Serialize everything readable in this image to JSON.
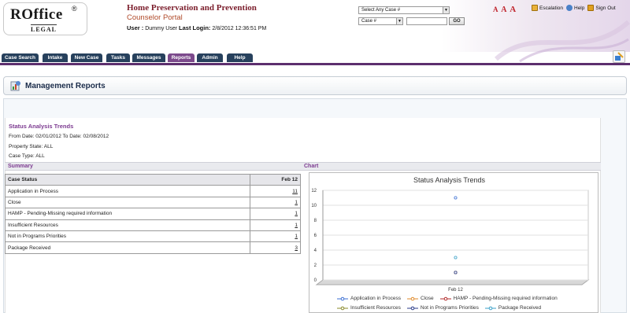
{
  "header": {
    "logo_main": "ROffice",
    "logo_reg": "®",
    "logo_sub": "LEGAL",
    "app_title": "Home Preservation and Prevention",
    "app_subtitle": "Counselor Portal",
    "user_label": "User :",
    "user_name": "Dummy User",
    "last_login_label": "Last Login:",
    "last_login_value": "2/8/2012 12:36:51 PM",
    "case_select": "Select Any Case #",
    "case_type_select": "Case #",
    "case_input_value": "",
    "go_label": "GO",
    "font_size_labels": [
      "A",
      "A",
      "A"
    ],
    "links": {
      "escalation": "Escalation",
      "help": "Help",
      "signout": "Sign Out"
    }
  },
  "nav": {
    "tabs": [
      "Case Search",
      "Intake",
      "New Case",
      "Tasks",
      "Messages",
      "Reports",
      "Admin",
      "Help"
    ],
    "active": "Reports"
  },
  "page": {
    "title": "Management Reports"
  },
  "report": {
    "title": "Status Analysis Trends",
    "date_range": "From Date: 02/01/2012 To Date: 02/08/2012",
    "property_state": "Property State: ALL",
    "case_type": "Case Type: ALL",
    "summary_label": "Summary",
    "chart_label": "Chart"
  },
  "table": {
    "headers": [
      "Case Status",
      "Feb 12"
    ],
    "rows": [
      [
        "Application in Process",
        "11"
      ],
      [
        "Close",
        "1"
      ],
      [
        "HAMP - Pending-Missing required information",
        "1"
      ],
      [
        "Insufficient Resources",
        "1"
      ],
      [
        "Not in Programs Priorities",
        "1"
      ],
      [
        "Package Received",
        "3"
      ]
    ]
  },
  "chart_data": {
    "type": "line",
    "title": "Status Analysis Trends",
    "categories": [
      "Feb 12"
    ],
    "ylim": [
      0,
      12
    ],
    "yticks": [
      0,
      2,
      4,
      6,
      8,
      10,
      12
    ],
    "grid": true,
    "legend_position": "bottom",
    "series": [
      {
        "name": "Application in Process",
        "values": [
          11
        ],
        "color": "#3b6fd4"
      },
      {
        "name": "Close",
        "values": [
          1
        ],
        "color": "#e08a2a"
      },
      {
        "name": "HAMP - Pending-Missing required information",
        "values": [
          1
        ],
        "color": "#b12a2a"
      },
      {
        "name": "Insufficient Resources",
        "values": [
          1
        ],
        "color": "#8a8a2a"
      },
      {
        "name": "Not in Programs Priorities",
        "values": [
          1
        ],
        "color": "#2a3b8a"
      },
      {
        "name": "Package Received",
        "values": [
          3
        ],
        "color": "#3aa0c8"
      }
    ]
  }
}
